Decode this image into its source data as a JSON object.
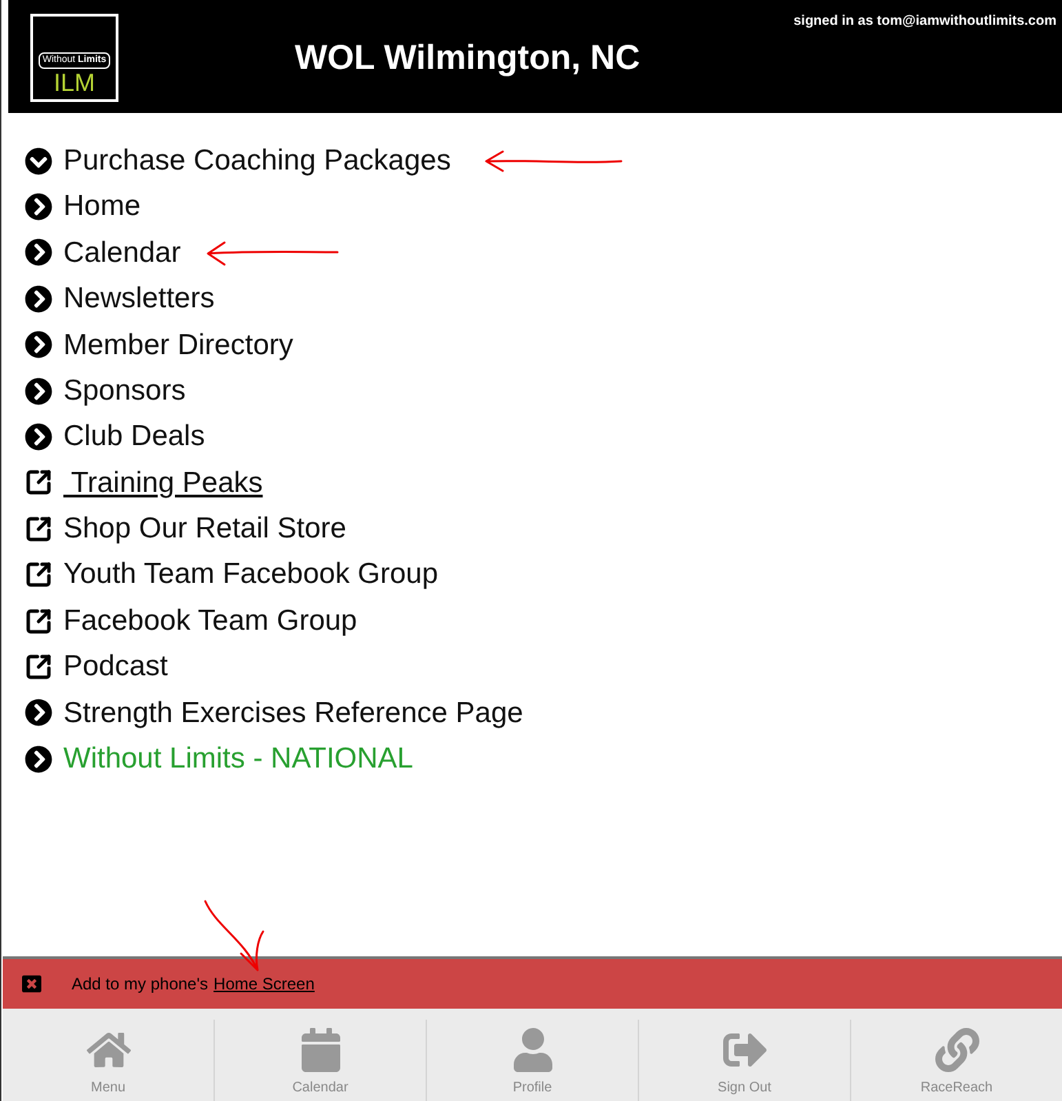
{
  "header": {
    "logo": {
      "wordmark": "Without **Limits**",
      "code": "ILM"
    },
    "title": "WOL Wilmington, NC",
    "signed_in": "signed in as tom@iamwithoutlimits.com"
  },
  "menu": [
    {
      "kind": "expand",
      "label": "Purchase Coaching Packages",
      "underlined": false,
      "highlighted": false
    },
    {
      "kind": "page",
      "label": "Home",
      "underlined": false,
      "highlighted": false
    },
    {
      "kind": "page",
      "label": "Calendar",
      "underlined": false,
      "highlighted": false
    },
    {
      "kind": "page",
      "label": "Newsletters",
      "underlined": false,
      "highlighted": false
    },
    {
      "kind": "page",
      "label": "Member Directory",
      "underlined": false,
      "highlighted": false
    },
    {
      "kind": "page",
      "label": "Sponsors",
      "underlined": false,
      "highlighted": false
    },
    {
      "kind": "page",
      "label": "Club Deals",
      "underlined": false,
      "highlighted": false
    },
    {
      "kind": "external",
      "label": " Training Peaks",
      "underlined": true,
      "highlighted": false
    },
    {
      "kind": "external",
      "label": "Shop Our Retail Store",
      "underlined": false,
      "highlighted": false
    },
    {
      "kind": "external",
      "label": "Youth Team Facebook Group",
      "underlined": false,
      "highlighted": false
    },
    {
      "kind": "external",
      "label": "Facebook Team Group",
      "underlined": false,
      "highlighted": false
    },
    {
      "kind": "external",
      "label": "Podcast",
      "underlined": false,
      "highlighted": false
    },
    {
      "kind": "page",
      "label": "Strength Exercises Reference Page",
      "underlined": false,
      "highlighted": false
    },
    {
      "kind": "page",
      "label": "Without Limits - NATIONAL",
      "underlined": false,
      "highlighted": true
    }
  ],
  "banner": {
    "text": "Add to my phone's",
    "link": "Home Screen"
  },
  "nav": [
    {
      "kind": "home",
      "label": "Menu"
    },
    {
      "kind": "calendar",
      "label": "Calendar"
    },
    {
      "kind": "profile",
      "label": "Profile"
    },
    {
      "kind": "signout",
      "label": "Sign Out"
    },
    {
      "kind": "link",
      "label": "RaceReach"
    }
  ]
}
